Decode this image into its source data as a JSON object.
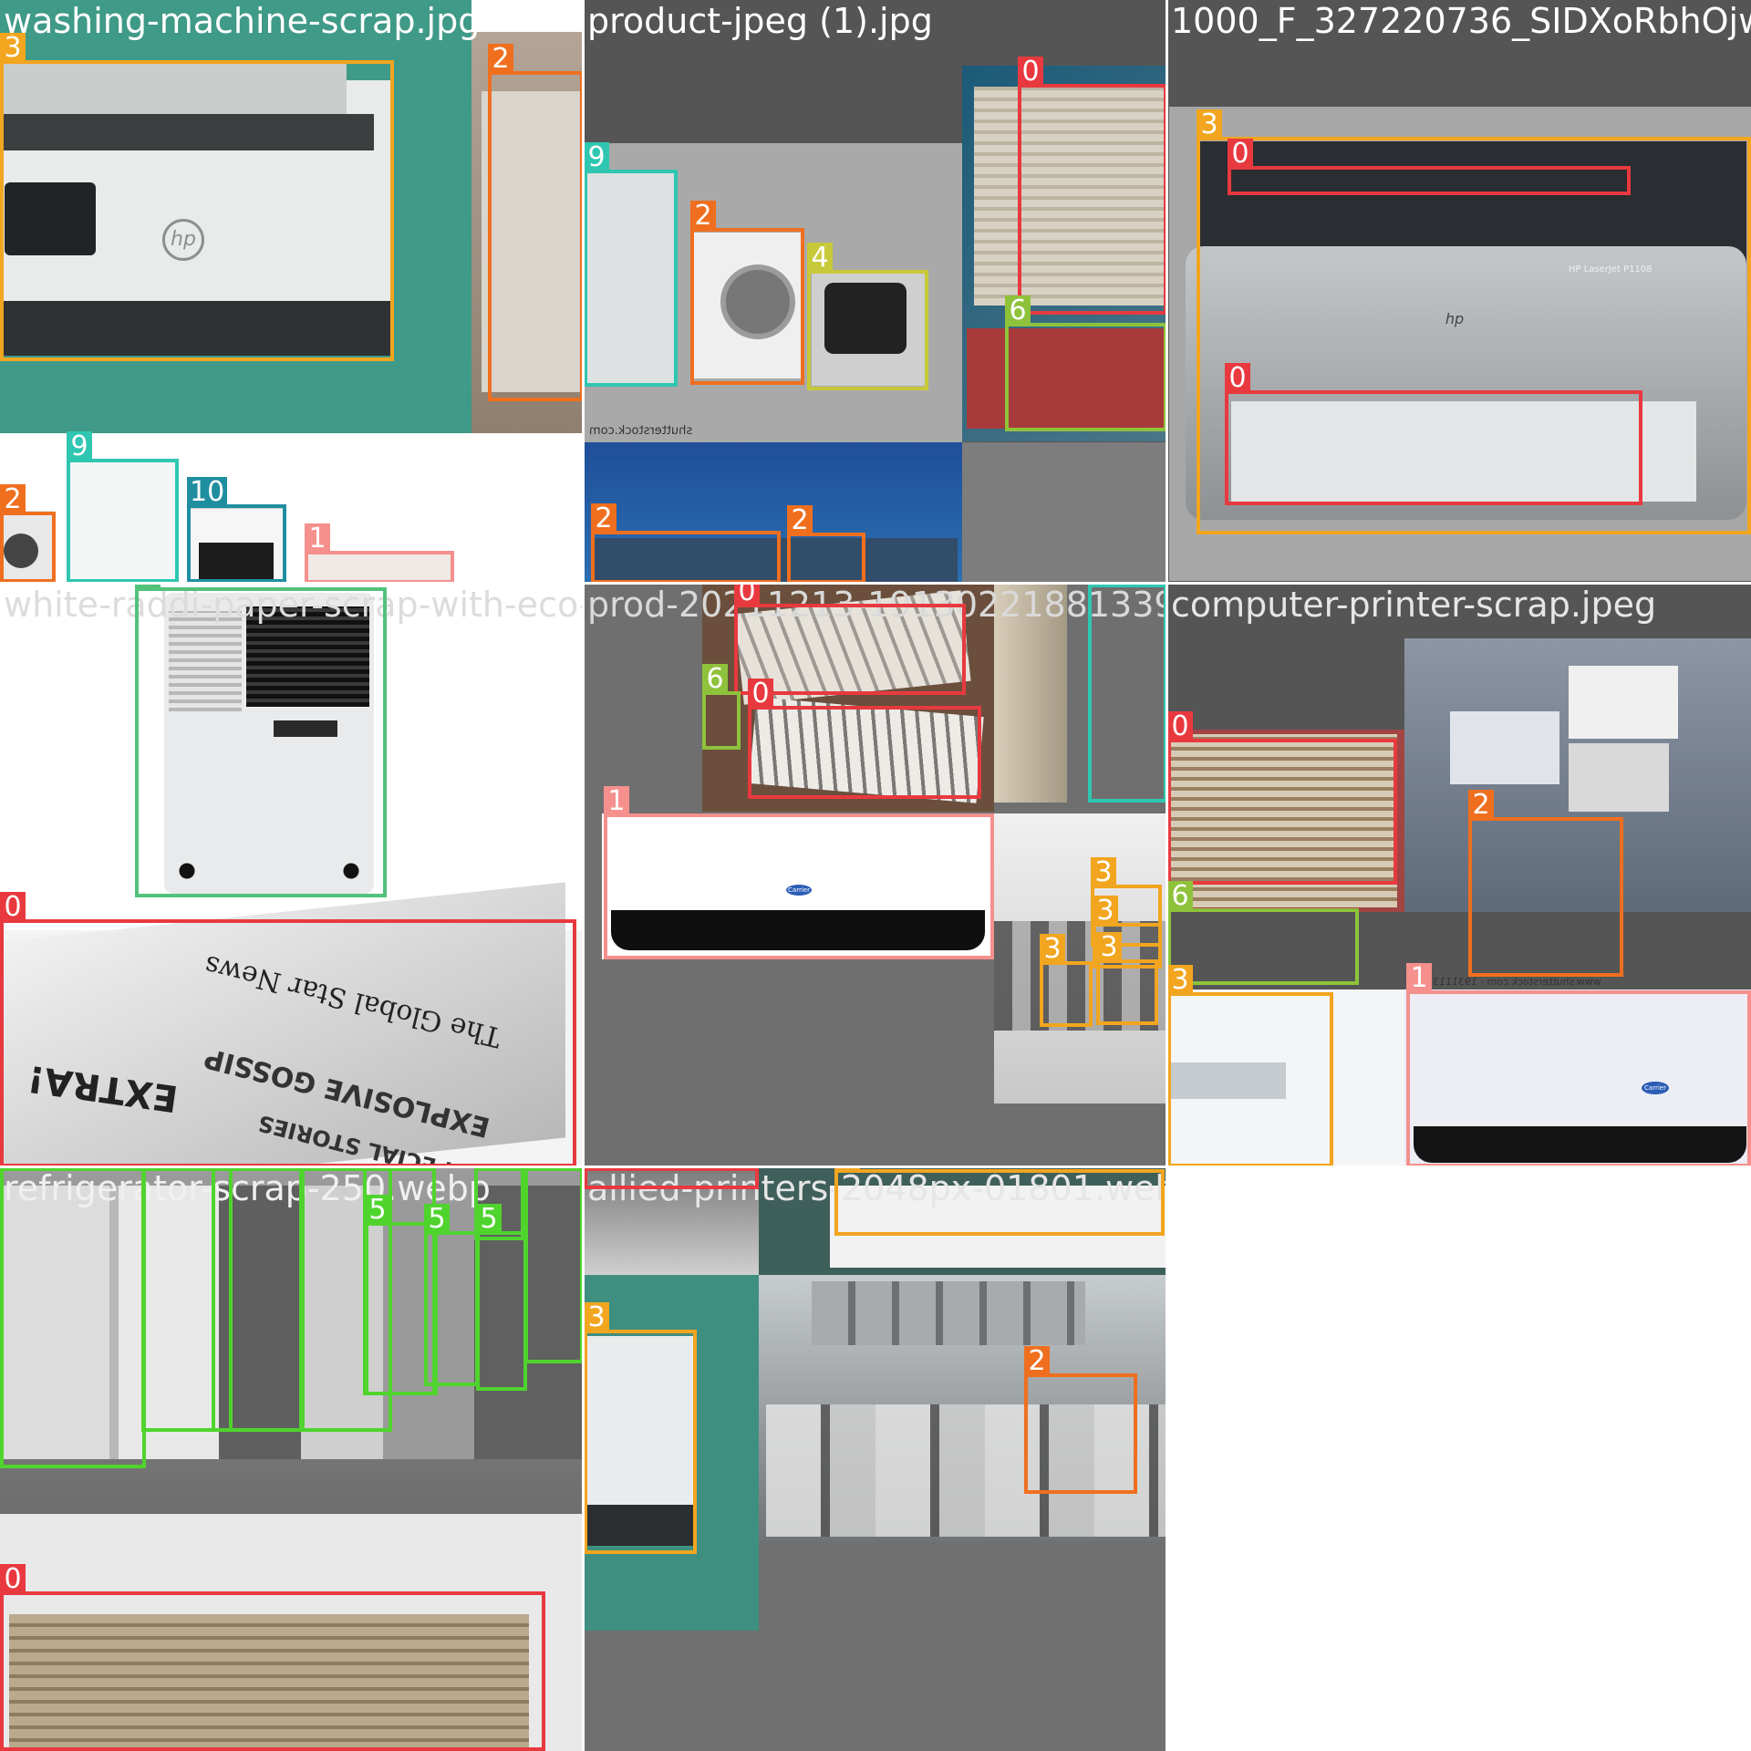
{
  "tile_titles": [
    "washing-machine-scrap.jpg",
    "product-jpeg (1).jpg",
    "1000_F_327220736_SIDXoRbhOjwys",
    "white-raddi-paper-scrap-with-eco-friend",
    "prod-20211213-1913022188133932337019804",
    "computer-printer-scrap.jpeg",
    "refrigerator-scrap-250.webp",
    "allied-printers-2048px-01801.webp"
  ],
  "class_colors": {
    "0": "#e8393f",
    "1": "#f5908d",
    "2": "#ef6f1f",
    "3": "#f2a51f",
    "4": "#c8c93a",
    "5": "#4fd42e",
    "6": "#8fc23b",
    "7": "#52c27a",
    "9": "#2fc7b2",
    "10": "#1f8fa0"
  },
  "box_labels": [
    "0",
    "1",
    "2",
    "3",
    "4",
    "5",
    "6",
    "7",
    "9",
    "10"
  ],
  "photo_text": {
    "stock_watermark": "shutterstock.com",
    "stock_watermark_full": "www.shutterstock.com · 1931113355",
    "newspaper_headlines": [
      "The Global Star News",
      "EXTRA!",
      "EXPLOSIVE GOSSIP",
      "SPECIAL STORIES"
    ],
    "printer_model": "HP LaserJet P1108",
    "brand": "hp",
    "ac_brand": "Carrier"
  }
}
